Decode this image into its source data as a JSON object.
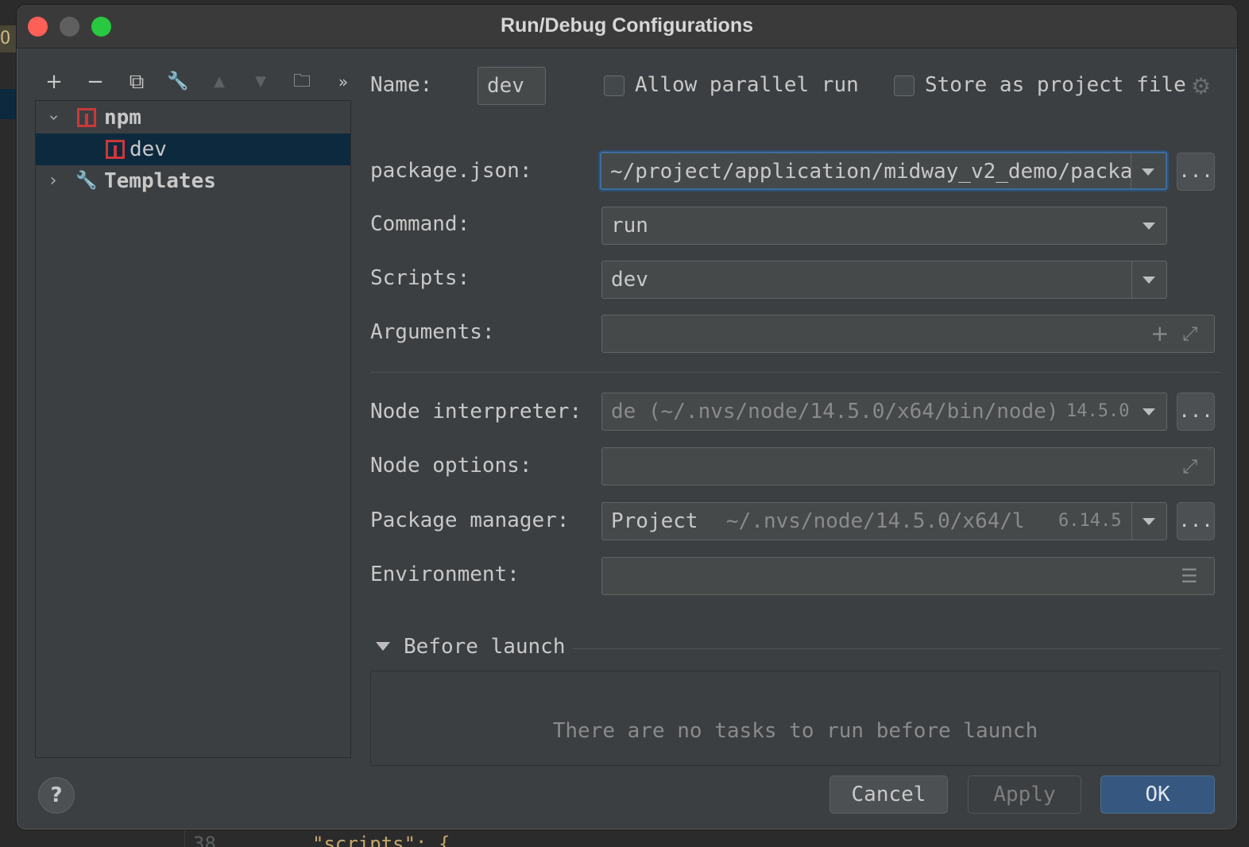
{
  "window": {
    "title": "Run/Debug Configurations"
  },
  "toolbar": {
    "add": "+",
    "remove": "−",
    "copy": "⧉",
    "edit": "🔧",
    "up": "▲",
    "down": "▼",
    "folder": "📁",
    "more": "»"
  },
  "tree": {
    "root_label": "npm",
    "child_label": "dev",
    "templates_label": "Templates"
  },
  "form": {
    "name_label": "Name:",
    "name_value": "dev",
    "allow_parallel_label": "Allow parallel run",
    "store_project_label": "Store as project file",
    "package_json_label": "package.json:",
    "package_json_value": "~/project/application/midway_v2_demo/packa",
    "command_label": "Command:",
    "command_value": "run",
    "scripts_label": "Scripts:",
    "scripts_value": "dev",
    "arguments_label": "Arguments:",
    "node_interpreter_label": "Node interpreter:",
    "node_interpreter_value": "de (~/.nvs/node/14.5.0/x64/bin/node)",
    "node_interpreter_version": "14.5.0",
    "node_options_label": "Node options:",
    "package_manager_label": "Package manager:",
    "package_manager_value": "Project",
    "package_manager_path": "~/.nvs/node/14.5.0/x64/l",
    "package_manager_version": "6.14.5",
    "environment_label": "Environment:",
    "browse_label": "...",
    "before_launch_label": "Before launch",
    "no_tasks_text": "There are no tasks to run before launch"
  },
  "buttons": {
    "cancel": "Cancel",
    "apply": "Apply",
    "ok": "OK",
    "help": "?"
  },
  "background": {
    "line_number": "38",
    "code": "\"scripts\": {"
  }
}
